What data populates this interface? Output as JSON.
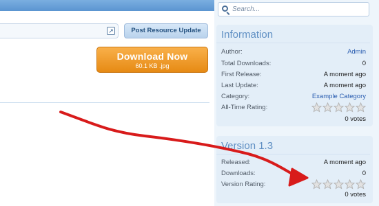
{
  "search": {
    "placeholder": "Search..."
  },
  "toolbar": {
    "post_update_label": "Post Resource Update"
  },
  "download": {
    "label": "Download Now",
    "file": "60.1 KB .jpg"
  },
  "info": {
    "title": "Information",
    "rows": [
      {
        "label": "Author:",
        "value": "Admin"
      },
      {
        "label": "Total Downloads:",
        "value": "0"
      },
      {
        "label": "First Release:",
        "value": "A moment ago"
      },
      {
        "label": "Last Update:",
        "value": "A moment ago"
      },
      {
        "label": "Category:",
        "value": "Example Category"
      },
      {
        "label": "All-Time Rating:",
        "stars": 5,
        "rating": 0
      }
    ],
    "votes": "0 votes"
  },
  "version": {
    "title": "Version 1.3",
    "rows": [
      {
        "label": "Released:",
        "value": "A moment ago"
      },
      {
        "label": "Downloads:",
        "value": "0"
      },
      {
        "label": "Version Rating:",
        "stars": 5,
        "rating": 0
      }
    ],
    "votes": "0 votes"
  },
  "colors": {
    "accent": "#5f8fc3",
    "download": "#f0a030",
    "link": "#2a5db0",
    "annotation": "#d81b1b"
  },
  "icons": [
    "search-icon",
    "external-link-icon",
    "star-icon"
  ]
}
